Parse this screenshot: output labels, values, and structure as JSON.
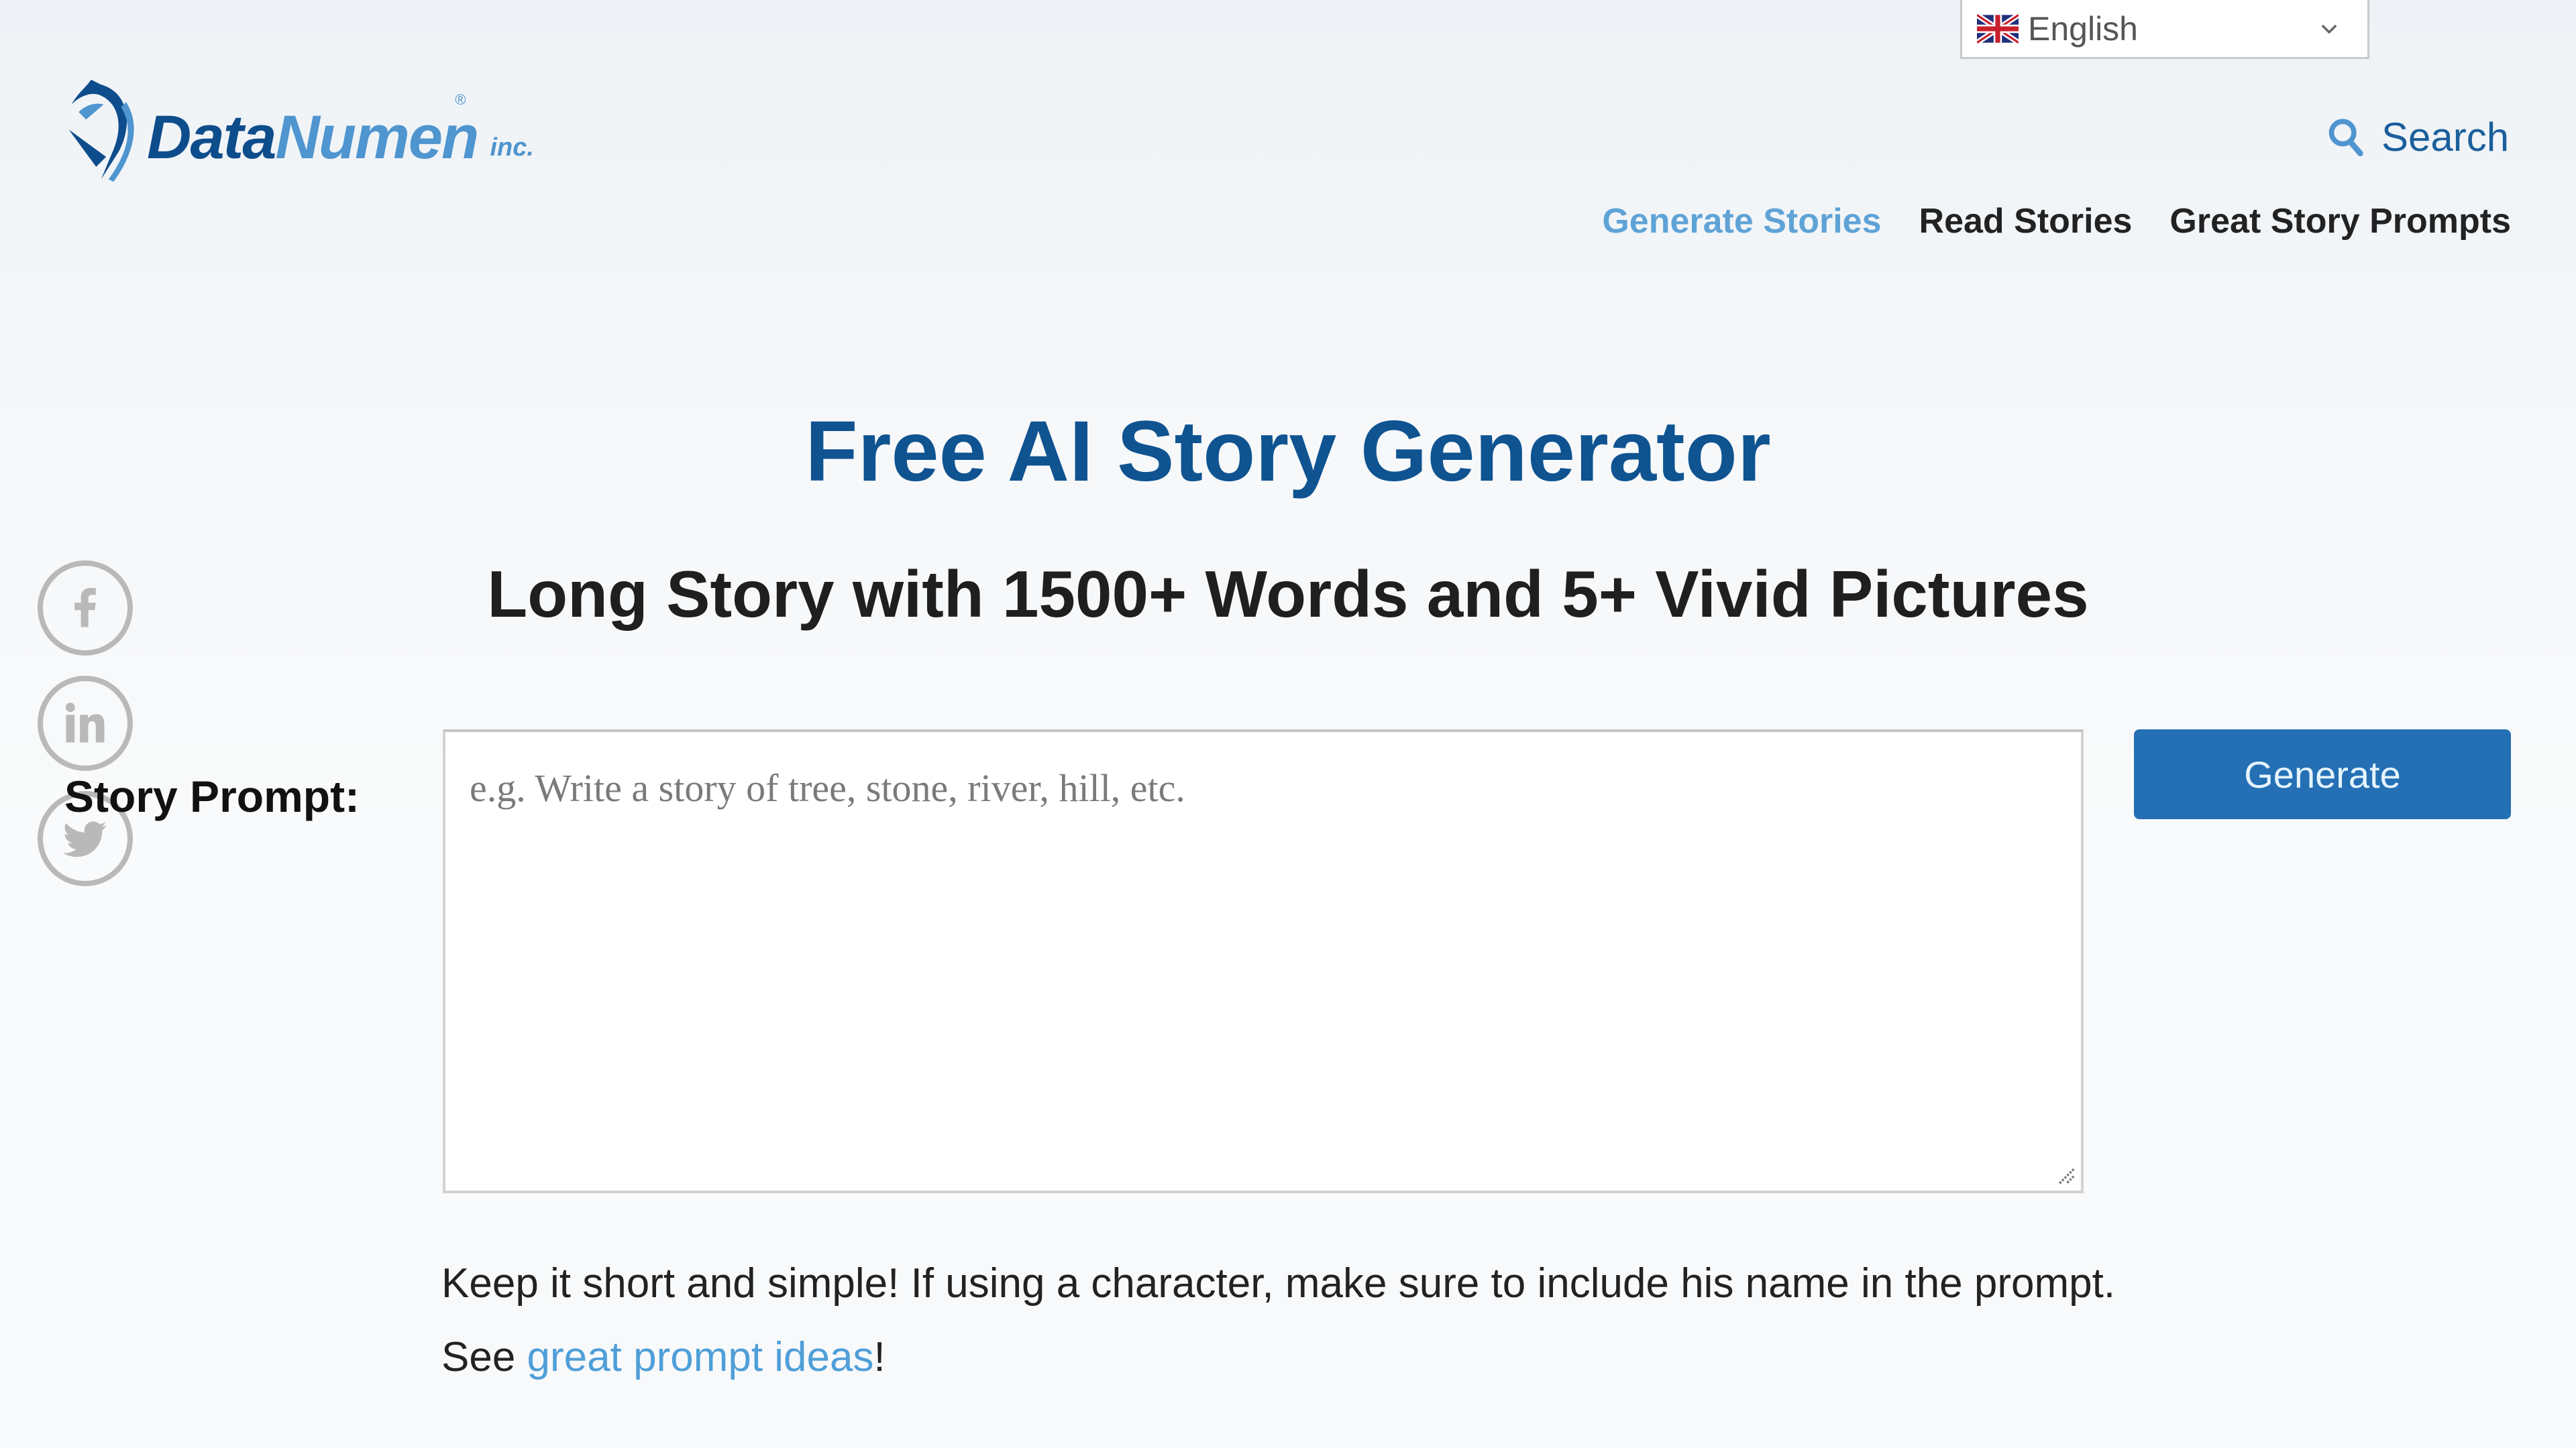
{
  "language_selector": {
    "selected": "English",
    "flag_icon": "uk-flag-icon"
  },
  "logo": {
    "part1": "Data",
    "part2": "Numen",
    "suffix": "inc.",
    "registered": "®"
  },
  "header": {
    "search_label": "Search"
  },
  "nav": {
    "items": [
      {
        "label": "Generate Stories",
        "active": true
      },
      {
        "label": "Read Stories",
        "active": false
      },
      {
        "label": "Great Story Prompts",
        "active": false
      }
    ]
  },
  "main": {
    "title": "Free AI Story Generator",
    "subtitle": "Long Story with 1500+ Words and 5+ Vivid Pictures",
    "prompt_label": "Story Prompt:",
    "prompt_value": "",
    "prompt_placeholder": "e.g. Write a story of tree, stone, river, hill, etc.",
    "generate_label": "Generate",
    "hint_text": "Keep it short and simple! If using a character, make sure to include his name in the prompt. See ",
    "hint_link": "great prompt ideas",
    "hint_end": "!"
  },
  "social": {
    "items": [
      "facebook",
      "linkedin",
      "twitter"
    ]
  },
  "colors": {
    "brand_dark": "#0f5391",
    "brand_light": "#5fa3d6",
    "button": "#2570b4",
    "link": "#4f9fd8"
  }
}
